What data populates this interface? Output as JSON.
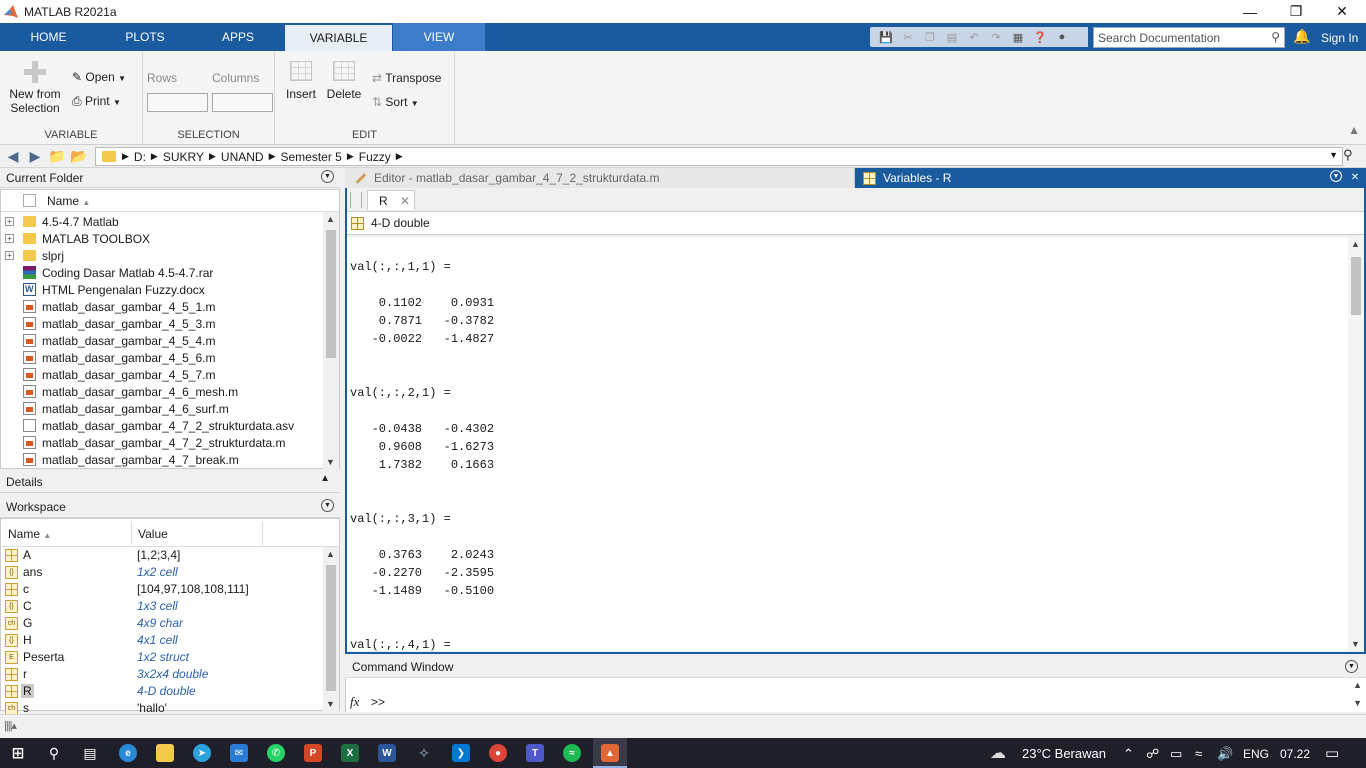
{
  "window": {
    "title": "MATLAB R2021a"
  },
  "ribbon_tabs": [
    "HOME",
    "PLOTS",
    "APPS",
    "VARIABLE",
    "VIEW"
  ],
  "search_doc": {
    "placeholder": "Search Documentation"
  },
  "signin_label": "Sign In",
  "ribbon": {
    "variable": {
      "new_from_selection": "New from Selection",
      "open": "Open",
      "print": "Print",
      "label": "VARIABLE"
    },
    "selection": {
      "rows": "Rows",
      "columns": "Columns",
      "label": "SELECTION"
    },
    "edit": {
      "insert": "Insert",
      "delete": "Delete",
      "transpose": "Transpose",
      "sort": "Sort",
      "label": "EDIT"
    }
  },
  "address": {
    "crumbs": [
      "D:",
      "SUKRY",
      "UNAND",
      "Semester 5",
      "Fuzzy"
    ]
  },
  "current_folder": {
    "title": "Current Folder",
    "col_name": "Name",
    "files": [
      {
        "name": "4.5-4.7 Matlab",
        "type": "folder"
      },
      {
        "name": "MATLAB TOOLBOX",
        "type": "folder"
      },
      {
        "name": "slprj",
        "type": "folder"
      },
      {
        "name": "Coding Dasar Matlab 4.5-4.7.rar",
        "type": "rar"
      },
      {
        "name": "HTML Pengenalan Fuzzy.docx",
        "type": "docx"
      },
      {
        "name": "matlab_dasar_gambar_4_5_1.m",
        "type": "m"
      },
      {
        "name": "matlab_dasar_gambar_4_5_3.m",
        "type": "m"
      },
      {
        "name": "matlab_dasar_gambar_4_5_4.m",
        "type": "m"
      },
      {
        "name": "matlab_dasar_gambar_4_5_6.m",
        "type": "m"
      },
      {
        "name": "matlab_dasar_gambar_4_5_7.m",
        "type": "m"
      },
      {
        "name": "matlab_dasar_gambar_4_6_mesh.m",
        "type": "m"
      },
      {
        "name": "matlab_dasar_gambar_4_6_surf.m",
        "type": "m"
      },
      {
        "name": "matlab_dasar_gambar_4_7_2_strukturdata.asv",
        "type": "asv"
      },
      {
        "name": "matlab_dasar_gambar_4_7_2_strukturdata.m",
        "type": "m"
      },
      {
        "name": "matlab_dasar_gambar_4_7_break.m",
        "type": "m"
      }
    ]
  },
  "details": {
    "title": "Details"
  },
  "workspace": {
    "title": "Workspace",
    "col_name": "Name",
    "col_value": "Value",
    "vars": [
      {
        "name": "A",
        "value": "[1,2;3,4]",
        "italic": false,
        "icon": "grid"
      },
      {
        "name": "ans",
        "value": "1x2 cell",
        "italic": true,
        "icon": "{}"
      },
      {
        "name": "c",
        "value": "[104,97,108,108,111]",
        "italic": false,
        "icon": "grid"
      },
      {
        "name": "C",
        "value": "1x3 cell",
        "italic": true,
        "icon": "{}"
      },
      {
        "name": "G",
        "value": "4x9 char",
        "italic": true,
        "icon": "ch"
      },
      {
        "name": "H",
        "value": "4x1 cell",
        "italic": true,
        "icon": "{}"
      },
      {
        "name": "Peserta",
        "value": "1x2 struct",
        "italic": true,
        "icon": "E"
      },
      {
        "name": "r",
        "value": "3x2x4 double",
        "italic": true,
        "icon": "grid"
      },
      {
        "name": "R",
        "value": "4-D double",
        "italic": true,
        "icon": "grid"
      },
      {
        "name": "s",
        "value": "'hallo'",
        "italic": false,
        "icon": "ch"
      }
    ]
  },
  "doc_tabs": {
    "editor": "Editor - matlab_dasar_gambar_4_7_2_strukturdata.m",
    "variables": "Variables - R"
  },
  "variable_view": {
    "subtab": "R",
    "info": "4-D double",
    "output_lines": [
      "val(:,:,1,1) =",
      "",
      "    0.1102    0.0931",
      "    0.7871   -0.3782",
      "   -0.0022   -1.4827",
      "",
      "",
      "val(:,:,2,1) =",
      "",
      "   -0.0438   -0.4302",
      "    0.9608   -1.6273",
      "    1.7382    0.1663",
      "",
      "",
      "val(:,:,3,1) =",
      "",
      "    0.3763    2.0243",
      "   -0.2270   -2.3595",
      "   -1.1489   -0.5100",
      "",
      "",
      "val(:,:,4,1) ="
    ]
  },
  "command_window": {
    "title": "Command Window",
    "fx": "fx",
    "prompt": ">>"
  },
  "taskbar": {
    "weather": "23°C  Berawan",
    "lang": "ENG",
    "time": "07.22"
  }
}
